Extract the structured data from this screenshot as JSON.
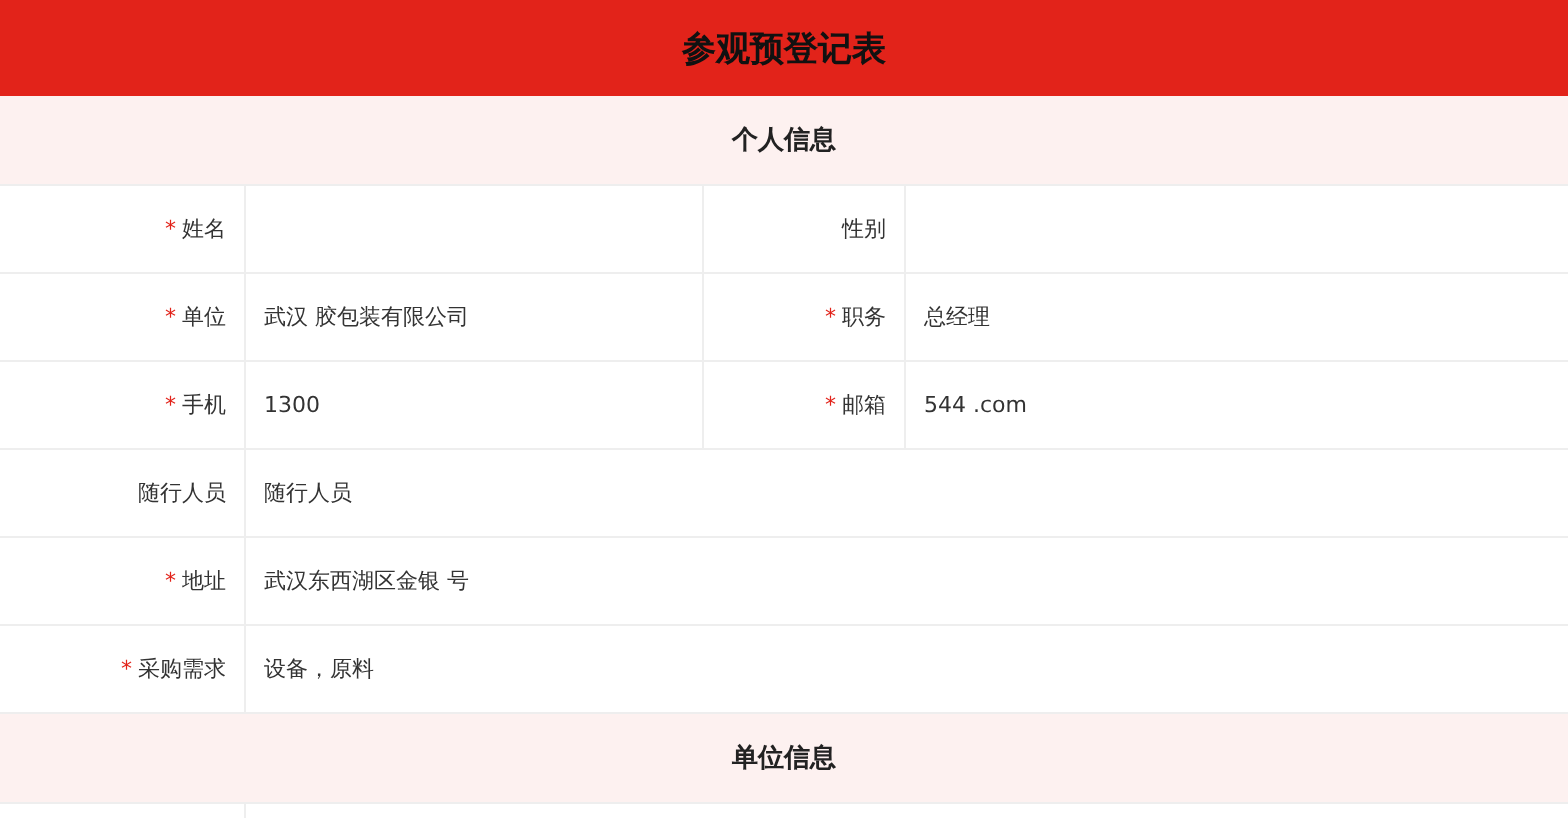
{
  "title": "参观预登记表",
  "sections": [
    {
      "heading": "个人信息",
      "rows": [
        {
          "fields": [
            {
              "mark": "*",
              "label": "姓名"
            },
            {
              "label": "性别"
            }
          ]
        },
        {
          "fields": [
            {
              "mark": "*",
              "label": "单位",
              "value": "武汉 胶包装有限公司"
            },
            {
              "mark": "*",
              "label": "职务",
              "value": "总经理"
            }
          ]
        },
        {
          "fields": [
            {
              "mark": "*",
              "label": "手机",
              "value": "1300"
            },
            {
              "mark": "*",
              "label": "邮箱",
              "value": "544 .com"
            }
          ]
        },
        {
          "fields": [
            {
              "label": "随行人员",
              "value": "随行人员"
            }
          ]
        },
        {
          "fields": [
            {
              "mark": "*",
              "label": "地址",
              "value": "武汉东西湖区金银 号"
            }
          ]
        },
        {
          "fields": [
            {
              "mark": "*",
              "label": "采购需求",
              "value": "设备，原料"
            }
          ]
        }
      ]
    },
    {
      "heading": "单位信息",
      "rows": [
        {
          "kind": "blank"
        }
      ]
    }
  ]
}
